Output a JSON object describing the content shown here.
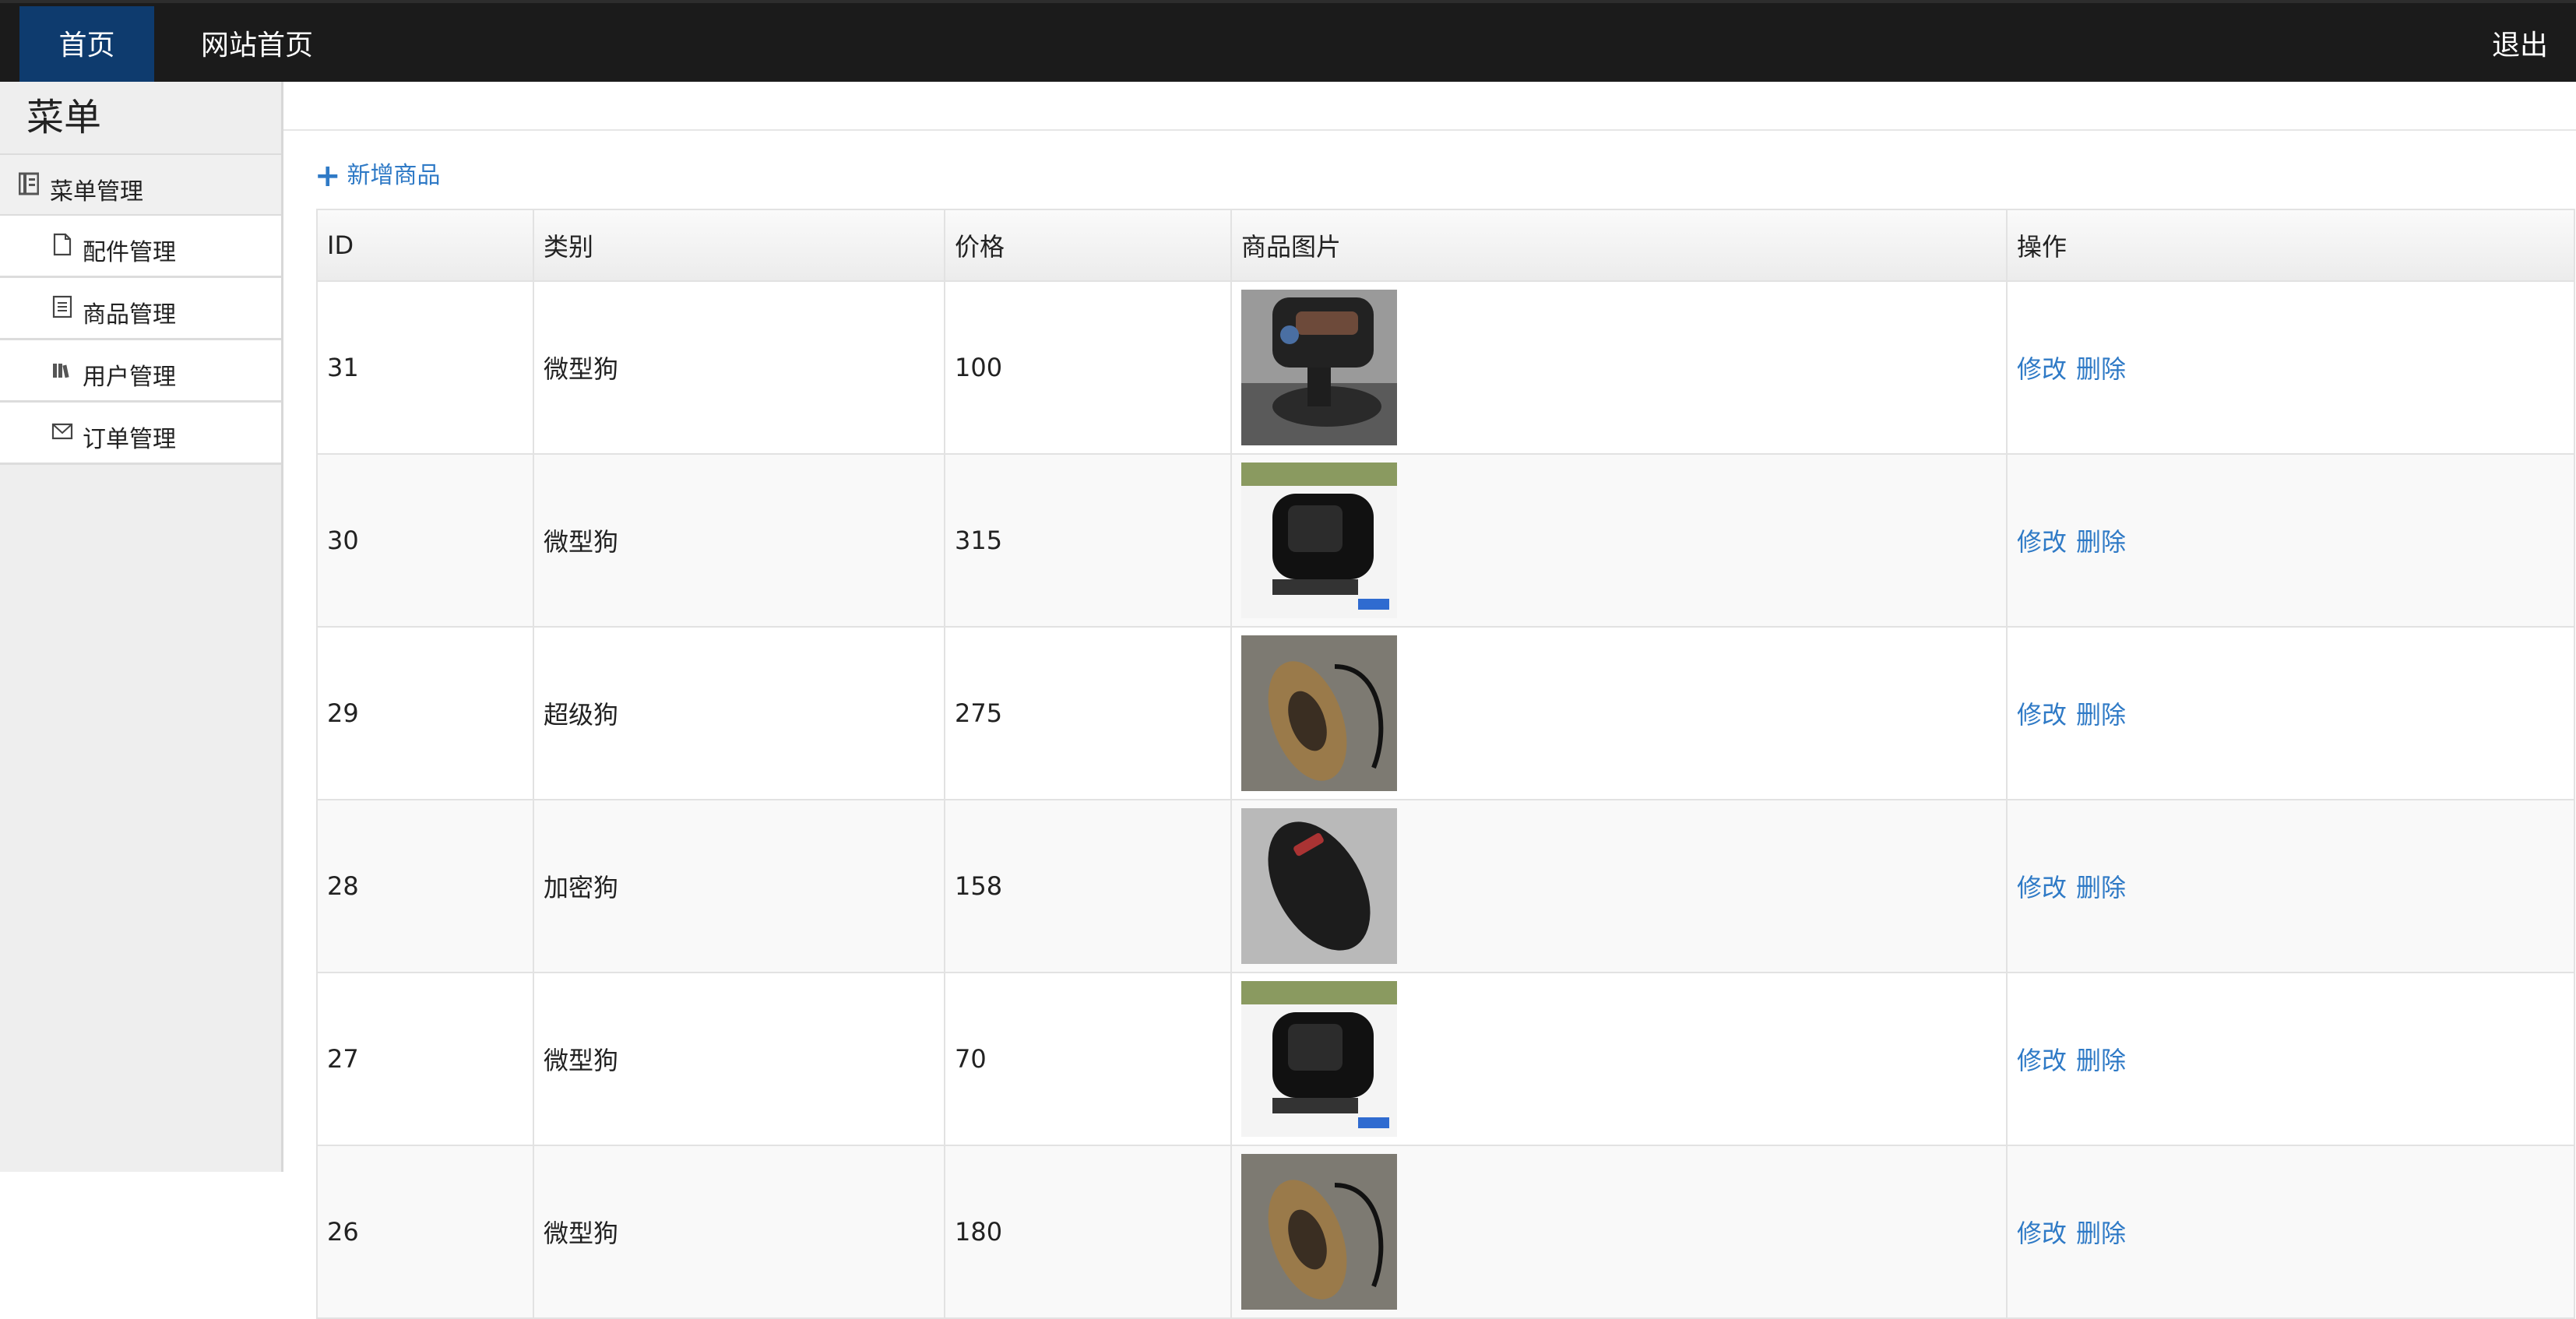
{
  "nav": {
    "home": "首页",
    "site": "网站首页",
    "logout": "退出"
  },
  "sidebar": {
    "title": "菜单",
    "group": "菜单管理",
    "items": [
      {
        "label": "配件管理",
        "icon": "file-icon"
      },
      {
        "label": "商品管理",
        "icon": "list-icon"
      },
      {
        "label": "用户管理",
        "icon": "books-icon"
      },
      {
        "label": "订单管理",
        "icon": "envelope-icon"
      }
    ]
  },
  "main": {
    "add_label": "新增商品",
    "columns": [
      "ID",
      "类别",
      "价格",
      "商品图片",
      "操作"
    ],
    "rows": [
      {
        "id": "31",
        "category": "微型狗",
        "price": "100",
        "image": "dashcam-mount",
        "edit": "修改",
        "delete": "删除"
      },
      {
        "id": "30",
        "category": "微型狗",
        "price": "315",
        "image": "black-device",
        "edit": "修改",
        "delete": "删除"
      },
      {
        "id": "29",
        "category": "超级狗",
        "price": "275",
        "image": "gold-device",
        "edit": "修改",
        "delete": "删除"
      },
      {
        "id": "28",
        "category": "加密狗",
        "price": "158",
        "image": "dark-detector",
        "edit": "修改",
        "delete": "删除"
      },
      {
        "id": "27",
        "category": "微型狗",
        "price": "70",
        "image": "black-device",
        "edit": "修改",
        "delete": "删除"
      },
      {
        "id": "26",
        "category": "微型狗",
        "price": "180",
        "image": "gold-device",
        "edit": "修改",
        "delete": "删除"
      }
    ]
  },
  "colors": {
    "accent": "#2f7ac6",
    "nav_bg": "#1b1b1b",
    "nav_active": "#0e3b6e"
  }
}
